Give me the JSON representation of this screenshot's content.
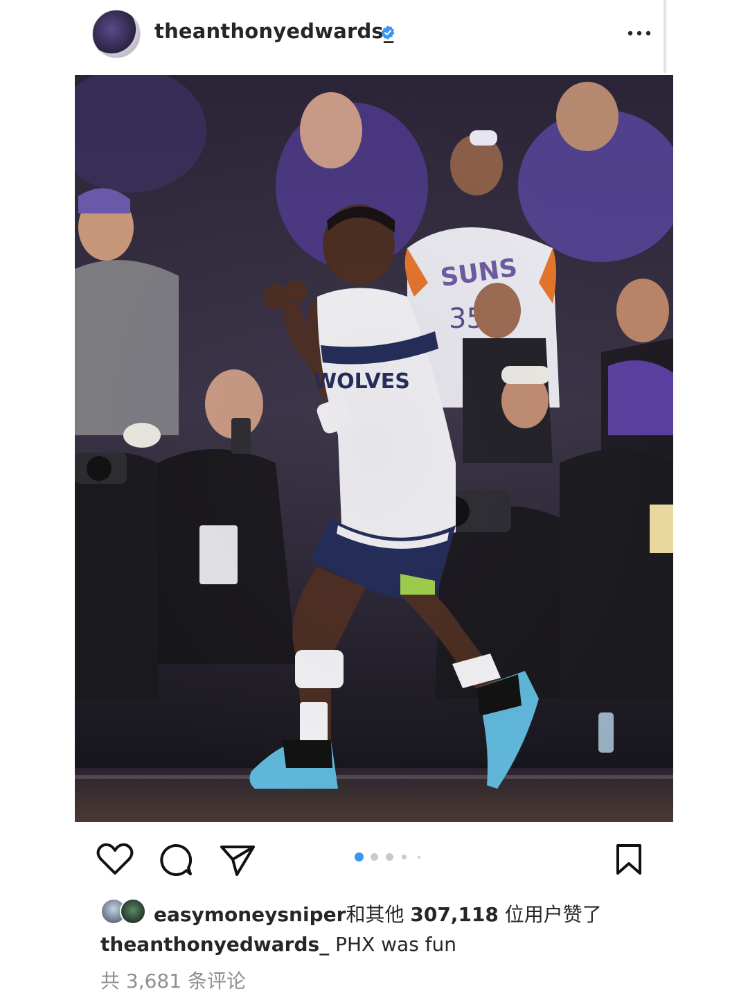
{
  "post": {
    "username": "theanthonyedwards_",
    "verified_icon": "verified-badge-icon",
    "more_icon": "more-options-icon"
  },
  "photo": {
    "jersey_front_text": "WOLVES",
    "fan_jersey_text": "SUNS",
    "fan_jersey_number": "35"
  },
  "actions": {
    "like_icon": "heart-icon",
    "comment_icon": "comment-icon",
    "share_icon": "send-icon",
    "save_icon": "bookmark-icon",
    "carousel_total": 5,
    "carousel_active": 1,
    "accent_color": "#3897f0"
  },
  "likes": {
    "liked_by_user": "easymoneysniper",
    "liked_by_connector": "和其他",
    "liked_count": "307,118",
    "liked_suffix": "位用户赞了"
  },
  "caption": {
    "username": "theanthonyedwards_",
    "text": "PHX was fun"
  },
  "comments": {
    "label": "共 3,681 条评论"
  }
}
